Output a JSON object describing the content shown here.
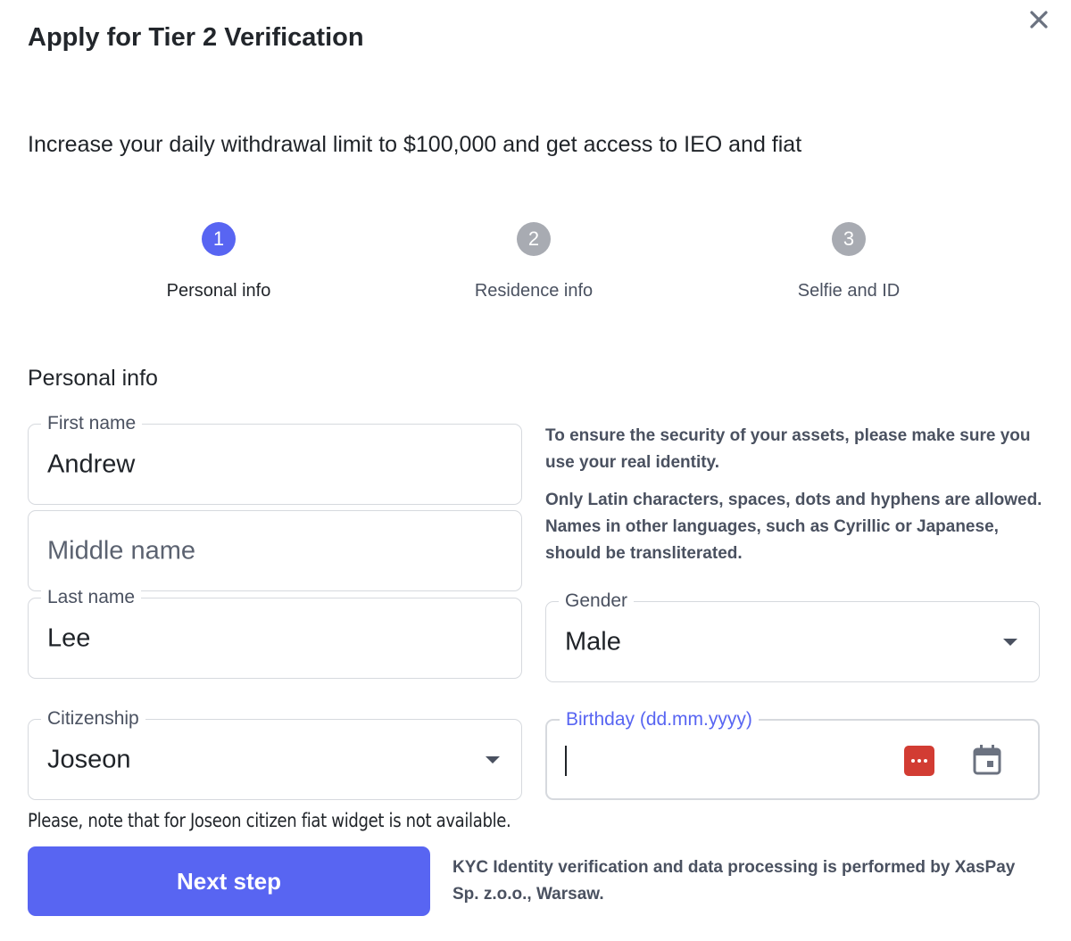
{
  "header": {
    "title": "Apply for Tier 2 Verification",
    "subtitle": "Increase your daily withdrawal limit to $100,000 and get access to IEO and fiat"
  },
  "steps": [
    {
      "number": "1",
      "label": "Personal info",
      "active": true
    },
    {
      "number": "2",
      "label": "Residence info",
      "active": false
    },
    {
      "number": "3",
      "label": "Selfie and ID",
      "active": false
    }
  ],
  "section_title": "Personal info",
  "form": {
    "first_name": {
      "label": "First name",
      "value": "Andrew"
    },
    "middle_name": {
      "placeholder": "Middle name"
    },
    "last_name": {
      "label": "Last name",
      "value": "Lee"
    },
    "gender": {
      "label": "Gender",
      "value": "Male"
    },
    "citizenship": {
      "label": "Citizenship",
      "value": "Joseon"
    },
    "birthday": {
      "label": "Birthday (dd.mm.yyyy)",
      "value": ""
    }
  },
  "notes": {
    "identity": "To ensure the security of your assets, please make sure you use your real identity.",
    "characters": "Only Latin characters, spaces, dots and hyphens are allowed. Names in other languages, such as Cyrillic or Japanese, should be transliterated."
  },
  "warning": "Please, note that for Joseon citizen fiat widget is not available.",
  "next_button": "Next step",
  "kyc_note": "KYC Identity verification and data processing is performed by XasPay Sp. z.o.o., Warsaw.",
  "icons": {
    "close": "close-icon",
    "password_manager": "password-manager-icon",
    "calendar": "calendar-icon",
    "dropdown": "chevron-down-icon"
  },
  "colors": {
    "accent": "#5865f2",
    "step_inactive": "#a8abb2",
    "password_manager": "#d23c33"
  }
}
